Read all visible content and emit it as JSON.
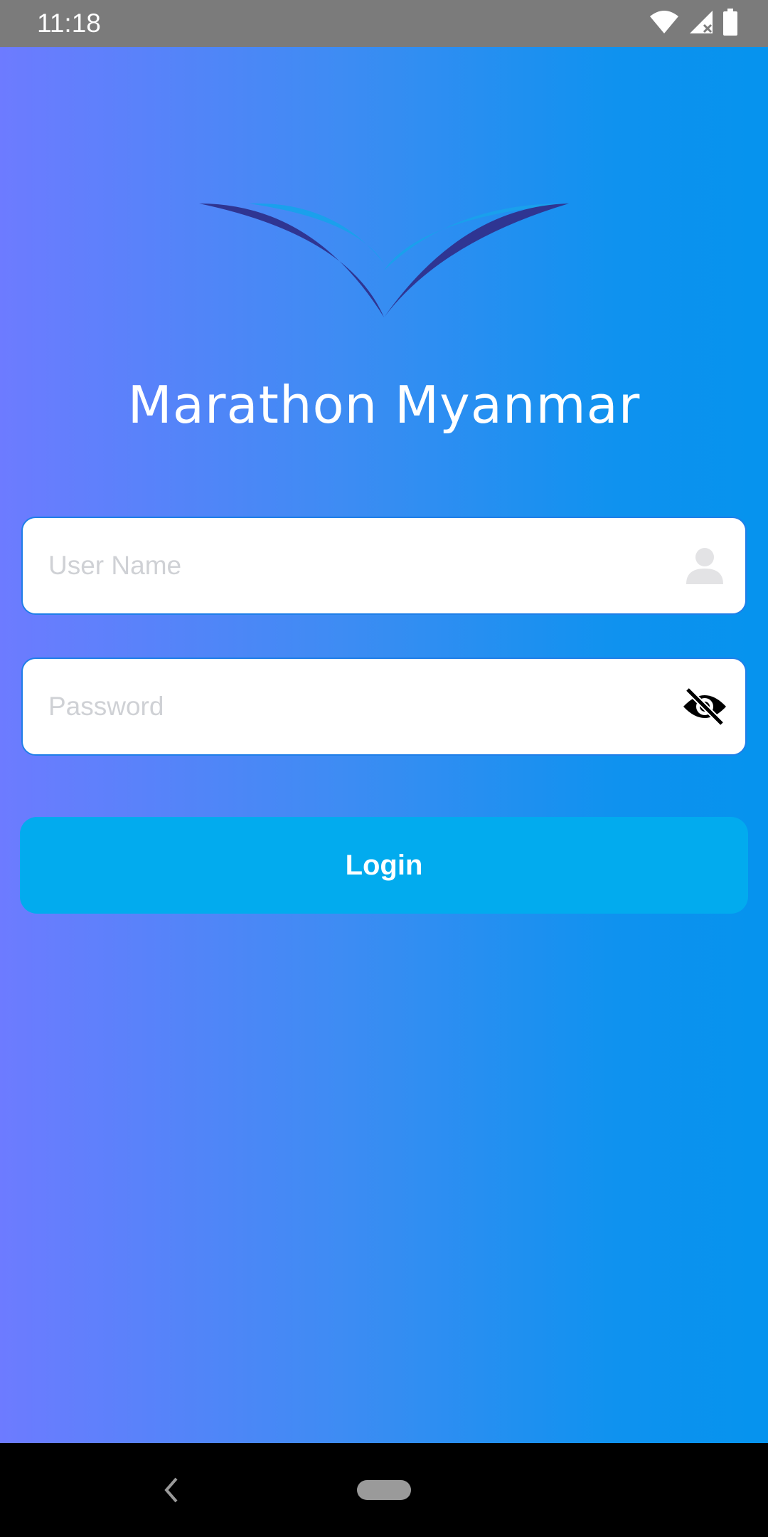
{
  "status_bar": {
    "time": "11:18",
    "icons": [
      "wifi-icon",
      "cell-signal-icon",
      "battery-icon"
    ]
  },
  "app": {
    "title": "Marathon Myanmar",
    "logo": "chevron-wings-logo"
  },
  "form": {
    "username": {
      "placeholder": "User Name",
      "value": "",
      "icon": "person-icon"
    },
    "password": {
      "placeholder": "Password",
      "value": "",
      "icon": "eye-off-icon"
    },
    "login_label": "Login"
  },
  "nav_bar": {
    "icons": [
      "back-icon",
      "home-pill-icon"
    ]
  },
  "colors": {
    "gradient_start": "#6d7bff",
    "gradient_end": "#0593ee",
    "button": "#02abee",
    "logo_dark": "#2f3592",
    "logo_light": "#1aa0ec"
  }
}
